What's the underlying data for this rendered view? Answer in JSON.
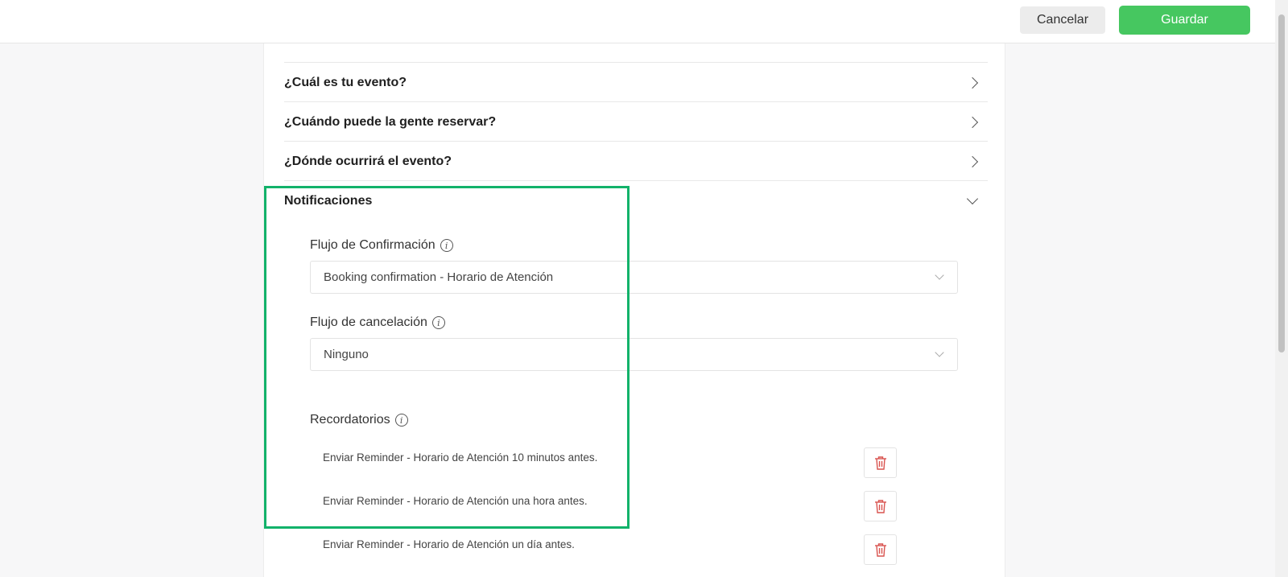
{
  "header": {
    "cancel_label": "Cancelar",
    "save_label": "Guardar"
  },
  "sections": [
    {
      "title": "¿Cuál es tu evento?",
      "icon": "chevron-right-icon"
    },
    {
      "title": "¿Cuándo puede la gente reservar?",
      "icon": "chevron-right-icon"
    },
    {
      "title": "¿Dónde ocurrirá el evento?",
      "icon": "chevron-right-icon"
    },
    {
      "title": "Notificaciones",
      "icon": "chevron-down-icon"
    }
  ],
  "notifications": {
    "confirmation_label": "Flujo de Confirmación",
    "confirmation_value": "Booking confirmation - Horario de Atención",
    "cancellation_label": "Flujo de cancelación",
    "cancellation_value": "Ninguno",
    "reminders_label": "Recordatorios",
    "info_icon_glyph": "i",
    "reminders": [
      "Enviar Reminder - Horario de Atención 10 minutos antes.",
      "Enviar Reminder - Horario de Atención una hora antes.",
      "Enviar Reminder - Horario de Atención un día antes."
    ]
  },
  "colors": {
    "primary_green": "#46c760",
    "highlight_green": "#12b26a",
    "trash_red": "#d9534f"
  }
}
